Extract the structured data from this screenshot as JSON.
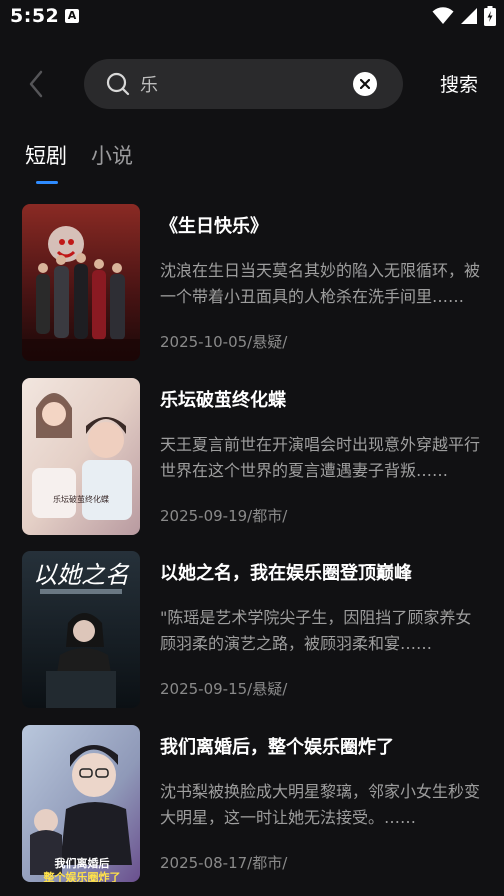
{
  "status_bar": {
    "time": "5:52",
    "notification_badge": "A"
  },
  "search": {
    "back_icon": "chevron-left-icon",
    "query": "乐",
    "clear_icon": "close-icon",
    "submit_label": "搜索"
  },
  "tabs": [
    {
      "label": "短剧",
      "active": true
    },
    {
      "label": "小说",
      "active": false
    }
  ],
  "colors": {
    "background": "#111113",
    "accent": "#2f8cff",
    "search_bg": "#2a2a2c"
  },
  "results": [
    {
      "title": "《生日快乐》",
      "description": "沈浪在生日当天莫名其妙的陷入无限循环，被一个带着小丑面具的人枪杀在洗手间里……",
      "meta": "2025-10-05/悬疑/"
    },
    {
      "title": "乐坛破茧终化蝶",
      "description": "天王夏言前世在开演唱会时出现意外穿越平行世界在这个世界的夏言遭遇妻子背叛……",
      "meta": "2025-09-19/都市/"
    },
    {
      "title": "以她之名，我在娱乐圈登顶巅峰",
      "description": "\"陈瑶是艺术学院尖子生，因阻挡了顾家养女顾羽柔的演艺之路，被顾羽柔和宴……",
      "meta": "2025-09-15/悬疑/"
    },
    {
      "title": "我们离婚后，整个娱乐圈炸了",
      "description": "沈书梨被换脸成大明星黎璃，邻家小女生秒变大明星，这一时让她无法接受。……",
      "meta": "2025-08-17/都市/"
    }
  ]
}
